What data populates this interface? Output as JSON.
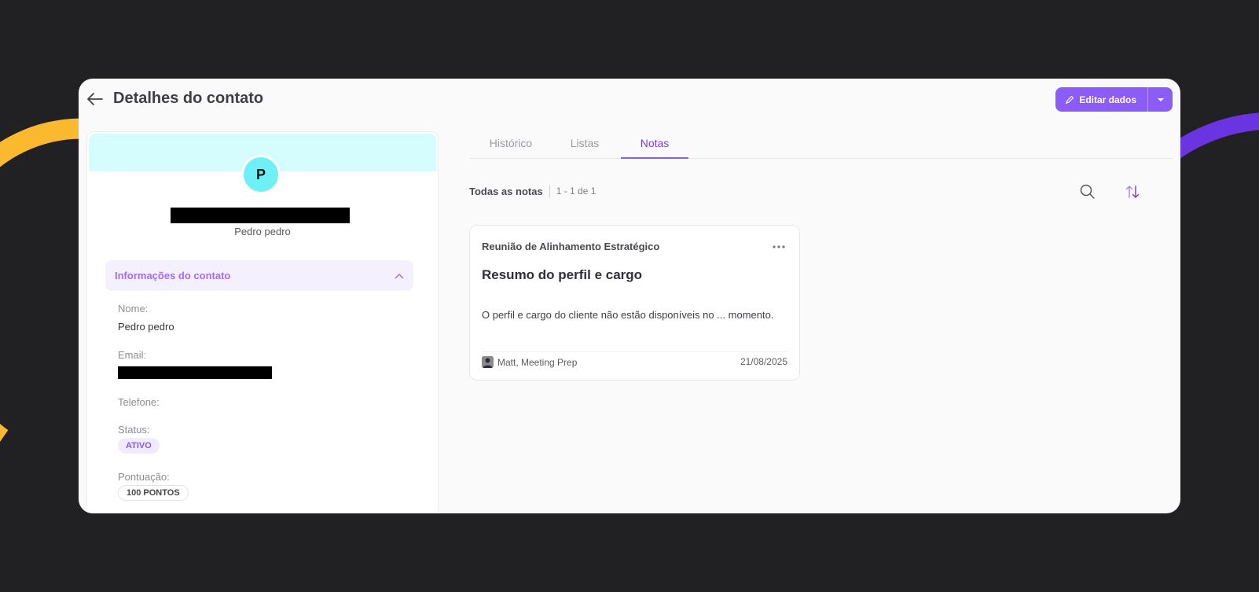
{
  "header": {
    "title": "Detalhes do contato",
    "edit_label": "Editar dados"
  },
  "contact": {
    "avatar_initial": "P",
    "subtitle": "Pedro pedro",
    "section_title": "Informações do contato",
    "fields": {
      "name_label": "Nome:",
      "name_value": "Pedro pedro",
      "email_label": "Email:",
      "phone_label": "Telefone:",
      "status_label": "Status:",
      "status_value": "ATIVO",
      "score_label": "Pontuação:",
      "score_value": "100 PONTOS"
    }
  },
  "tabs": [
    {
      "label": "Histórico"
    },
    {
      "label": "Listas"
    },
    {
      "label": "Notas"
    }
  ],
  "notes": {
    "list_title": "Todas as notas",
    "count": "1 - 1 de 1",
    "items": [
      {
        "title": "Reunião de Alinhamento Estratégico",
        "heading": "Resumo do perfil e cargo",
        "body": "O perfil e cargo do cliente não estão disponíveis no ... momento.",
        "author": "Matt, Meeting Prep",
        "date": "21/08/2025"
      }
    ]
  },
  "colors": {
    "accent": "#8b5cf6",
    "accent_dark": "#7b3fe4",
    "avatar_bg": "#6ff0f7",
    "cover_bg": "#d6fdfd",
    "deco_yellow": "#fbb92f",
    "deco_purple": "#6a35e0"
  },
  "icons": {
    "back": "arrow-left-icon",
    "edit": "pencil-icon",
    "caret": "chevron-down-icon",
    "collapse": "chevron-up-icon",
    "search": "search-icon",
    "sort": "sort-icon",
    "more": "more-horizontal-icon"
  }
}
